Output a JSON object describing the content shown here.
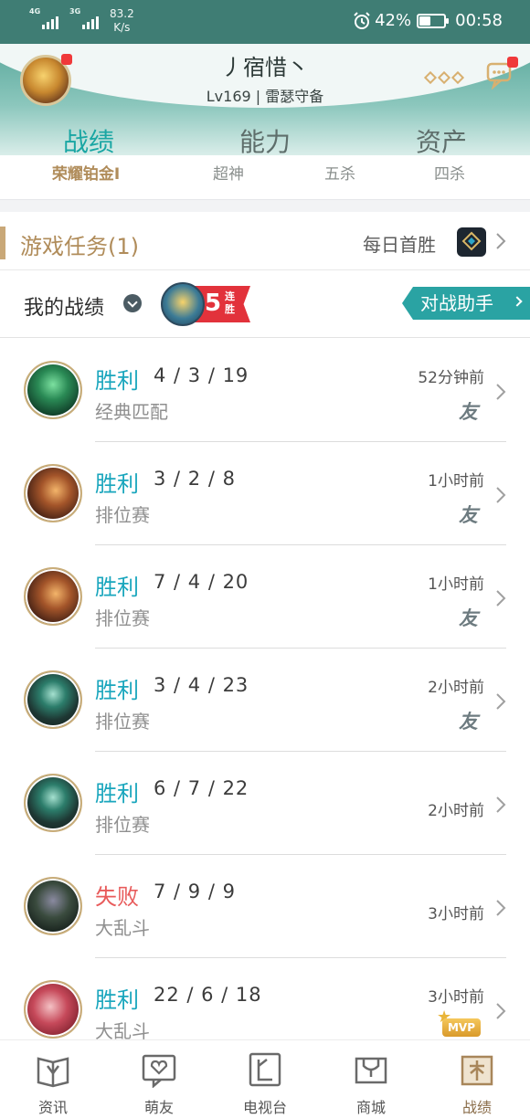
{
  "status_bar": {
    "network_1": "4G",
    "network_2": "3G",
    "speed": "83.2",
    "speed_unit": "K/s",
    "battery": "42%",
    "battery_level": 0.42,
    "time": "00:58"
  },
  "profile": {
    "name": "丿宿惜丶",
    "level": "Lv169 | 雷瑟守备"
  },
  "tabs": [
    {
      "label": "战绩",
      "active": true
    },
    {
      "label": "能力",
      "active": false
    },
    {
      "label": "资产",
      "active": false
    }
  ],
  "rank_peek": [
    "荣耀铂金Ⅰ",
    "超神",
    "五杀",
    "四杀"
  ],
  "tasks": {
    "title": "游戏任务(1)",
    "daily": "每日首胜"
  },
  "records": {
    "title": "我的战绩",
    "streak_number": "5",
    "streak_label": "连胜",
    "assistant": "对战助手"
  },
  "matches": [
    {
      "result": "胜利",
      "kda": "4 / 3 / 19",
      "mode": "经典匹配",
      "time": "52分钟前",
      "friend": "友",
      "mvp": ""
    },
    {
      "result": "胜利",
      "kda": "3 / 2 / 8",
      "mode": "排位赛",
      "time": "1小时前",
      "friend": "友",
      "mvp": ""
    },
    {
      "result": "胜利",
      "kda": "7 / 4 / 20",
      "mode": "排位赛",
      "time": "1小时前",
      "friend": "友",
      "mvp": ""
    },
    {
      "result": "胜利",
      "kda": "3 / 4 / 23",
      "mode": "排位赛",
      "time": "2小时前",
      "friend": "友",
      "mvp": ""
    },
    {
      "result": "胜利",
      "kda": "6 / 7 / 22",
      "mode": "排位赛",
      "time": "2小时前",
      "friend": "",
      "mvp": ""
    },
    {
      "result": "失败",
      "kda": "7 / 9 / 9",
      "mode": "大乱斗",
      "time": "3小时前",
      "friend": "",
      "mvp": ""
    },
    {
      "result": "胜利",
      "kda": "22 / 6 / 18",
      "mode": "大乱斗",
      "time": "3小时前",
      "friend": "",
      "mvp": "MVP"
    }
  ],
  "bottom_nav": [
    {
      "label": "资讯",
      "icon": "news-icon",
      "active": false
    },
    {
      "label": "萌友",
      "icon": "friends-icon",
      "active": false
    },
    {
      "label": "电视台",
      "icon": "tv-icon",
      "active": false
    },
    {
      "label": "商城",
      "icon": "shop-icon",
      "active": false
    },
    {
      "label": "战绩",
      "icon": "records-icon",
      "active": true
    }
  ],
  "colors": {
    "status_bar": "#3f7d74",
    "accent_teal": "#19a6a3",
    "win": "#1aa6bd",
    "lose": "#e85b5b",
    "gold": "#b08c5a"
  }
}
